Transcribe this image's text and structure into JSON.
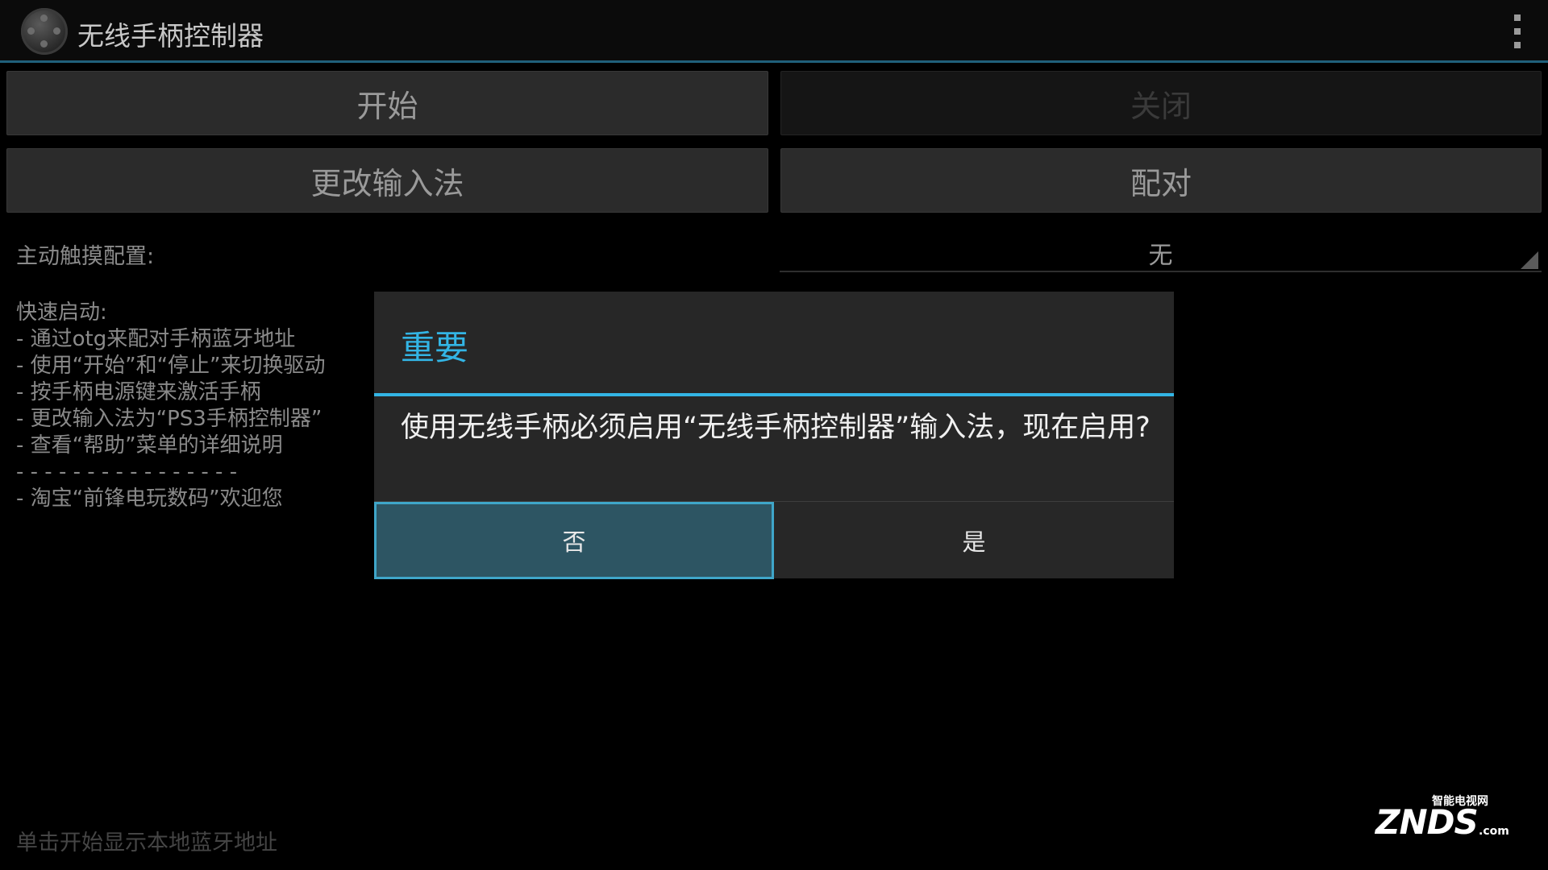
{
  "app": {
    "title": "无线手柄控制器"
  },
  "buttons": {
    "start": "开始",
    "close": "关闭",
    "change_input": "更改输入法",
    "pair": "配对"
  },
  "touch_config": {
    "label": "主动触摸配置:",
    "value": "无"
  },
  "quick_start": {
    "heading": "快速启动:",
    "lines": [
      "- 通过otg来配对手柄蓝牙地址",
      "- 使用“开始”和“停止”来切换驱动",
      "- 按手柄电源键来激活手柄",
      "- 更改输入法为“PS3手柄控制器”",
      "- 查看“帮助”菜单的详细说明",
      "- - - - - - - - - - - - - - - -",
      "- 淘宝“前锋电玩数码”欢迎您"
    ]
  },
  "hint": "单击开始显示本地蓝牙地址",
  "dialog": {
    "title": "重要",
    "message": "使用无线手柄必须启用“无线手柄控制器”输入法，现在启用?",
    "no": "否",
    "yes": "是"
  },
  "watermark": {
    "logo": "ZNDS",
    "sub": "智能电视网",
    "suffix": ".com"
  },
  "colors": {
    "accent": "#33b5e5",
    "background": "#000000",
    "dialog_bg": "#272727"
  }
}
